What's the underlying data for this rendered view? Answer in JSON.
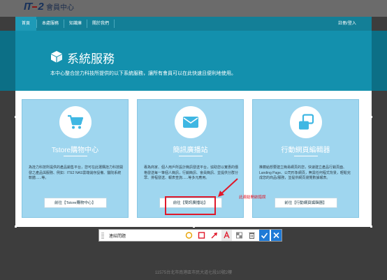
{
  "header": {
    "logo_text": "IT",
    "logo_text_2": "2",
    "subtitle": "會員中心"
  },
  "nav": {
    "items": [
      "首頁",
      "本處服務",
      "知識庫",
      "關於我們"
    ],
    "login": "註冊/登入"
  },
  "hero": {
    "title": "系統服務",
    "description": "本中心整合詮力科技所提供的以下系統服務，讓所有會員可以在此快速且便利地使用。",
    "icon": "cube-icon"
  },
  "cards": [
    {
      "icon": "cart-icon",
      "title": "Tstore購物中心",
      "description": "為詮力科技所提供的產品銷售平台，您可在此選購詮力科技開發之產品與服務、例如：ITE2 NAS雲端儲存設備、醫院系統軟體......等。",
      "button": "前往【Tstore購物中心】"
    },
    {
      "icon": "envelope-icon",
      "title": "簡訊廣播站",
      "description": "專為商家、個人用戶所設計簡訊發送平台，協助您以實惠的價格發送每一筆個人簡訊，行銷簡訊、會員簡訊、並提供分群分眾、排程發送、報表查詢......等多元應用。",
      "button": "前往【簡訊廣播站】"
    },
    {
      "icon": "windows-icon",
      "title": "行動網頁編輯器",
      "description": "推薦給想要建立簡易網頁的您，快速建立產品行銷頁面、Landing Page、公司形象網頁，無需任何程式背景，輕鬆完成您的商品/服務，並提供網頁瀏覽數據報表。",
      "button": "前往【行動網頁編輯器】"
    }
  ],
  "annotation": {
    "text": "此連結開啟錯誤",
    "color": "#e0182a"
  },
  "snip_toolbar": {
    "label": "連結問題",
    "tools": [
      "ellipse-icon",
      "rectangle-icon",
      "arrow-icon",
      "text-icon",
      "mosaic-icon",
      "trash-icon",
      "check-icon",
      "close-icon"
    ]
  },
  "footer": {
    "address": "11575台北市南港區市民大道七段10號2樓"
  },
  "colors": {
    "nav": "#137f97",
    "hero": "#1390ad",
    "card": "#9fd6ef",
    "accent_blue": "#1f7ad6",
    "annotation": "#e0182a"
  }
}
